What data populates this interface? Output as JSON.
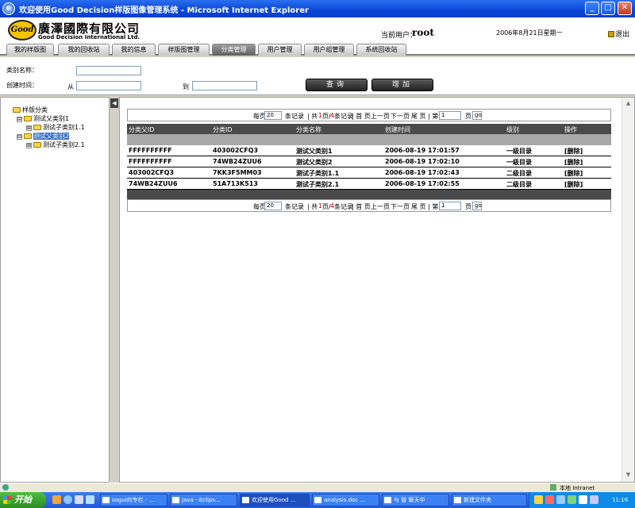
{
  "window": {
    "title": "欢迎使用Good Decision样版图像管理系统 - Microsoft Internet Explorer",
    "minimize": "_",
    "maximize": "□",
    "close": "✕"
  },
  "header": {
    "logo_text": "Good",
    "company_zh": "廣澤國際有限公司",
    "company_en": "Good Decision International Ltd.",
    "user_label": "当前用户：",
    "user_name": "root",
    "date": "2006年8月21日星期一",
    "logout": "退出"
  },
  "nav": {
    "tabs": [
      {
        "label": "我的样版图"
      },
      {
        "label": "我的回收站"
      },
      {
        "label": "我的信息"
      },
      {
        "label": "样版图管理"
      },
      {
        "label": "分类管理"
      },
      {
        "label": "用户管理"
      },
      {
        "label": "用户组管理"
      },
      {
        "label": "系统回收站"
      }
    ],
    "active_index": 4
  },
  "filter": {
    "category_label": "类别名称：",
    "created_label": "创建时间：",
    "from_label": "从",
    "to_label": "到",
    "search_button": "查询",
    "add_button": "增加"
  },
  "tree": {
    "root": "样版分类",
    "nodes": [
      {
        "label": "测试父类别1",
        "expander": "⊟"
      },
      {
        "label": "测试子类别1.1",
        "expander": "⊞"
      },
      {
        "label": "测试父类别2",
        "expander": "⊟",
        "selected": true
      },
      {
        "label": "测试子类别2.1",
        "expander": "⊞"
      }
    ],
    "collapse_glyph": "◀"
  },
  "pager": {
    "per_page_label": "每页",
    "per_page_value": "20",
    "records_label": "条记录",
    "page_prefix": "| 共",
    "current_page": "1",
    "page_sep": "页/",
    "total_records": "4",
    "records_suffix": "条记录",
    "first": "| 首 页",
    "prev": "上一页",
    "next": "下一页",
    "last": "尾 页",
    "goto_prefix": "| 第",
    "goto_value": "1",
    "goto_suffix": "页",
    "go": "go"
  },
  "grid": {
    "columns": [
      "分类父ID",
      "分类ID",
      "分类名称",
      "创建时间",
      "级别",
      "操作"
    ],
    "rows": [
      [
        "FFFFFFFFFF",
        "403002CFQ3",
        "测试父类别1",
        "2006-08-19 17:01:57",
        "一级目录",
        "[删除]"
      ],
      [
        "FFFFFFFFFF",
        "74WB24ZUU6",
        "测试父类别2",
        "2006-08-19 17:02:10",
        "一级目录",
        "[删除]"
      ],
      [
        "403002CFQ3",
        "7KK3F5MM03",
        "测试子类别1.1",
        "2006-08-19 17:02:43",
        "二级目录",
        "[删除]"
      ],
      [
        "74WB24ZUU6",
        "51A713K513",
        "测试子类别2.1",
        "2006-08-19 17:02:55",
        "二级目录",
        "[删除]"
      ]
    ]
  },
  "scroll": {
    "up": "▲",
    "down": "▼"
  },
  "status": {
    "zone": "本地 Intranet"
  },
  "taskbar": {
    "start": "开始",
    "items": [
      {
        "label": "sogui的专栏 - ..."
      },
      {
        "label": "Java - Eclips..."
      },
      {
        "label": "欢迎使用Good ..."
      },
      {
        "label": "analysis.doc ..."
      },
      {
        "label": "与 智 聊天中"
      },
      {
        "label": "新建文件夹"
      }
    ],
    "clock": "11:16"
  },
  "colors": {
    "titlebar": "#0a46d8",
    "nav_active": "#606060",
    "grid_header": "#4a4a4a",
    "tree_selected": "#316ac5",
    "taskbar": "#2359d6",
    "start": "#2d8a22"
  }
}
